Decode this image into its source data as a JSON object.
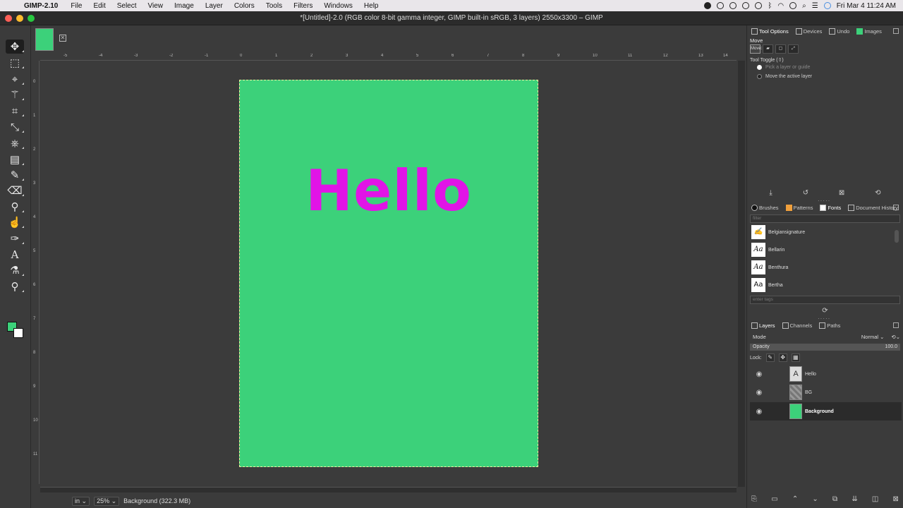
{
  "macos_menubar": {
    "app_name": "GIMP-2.10",
    "menus": [
      "File",
      "Edit",
      "Select",
      "View",
      "Image",
      "Layer",
      "Colors",
      "Tools",
      "Filters",
      "Windows",
      "Help"
    ],
    "clock": "Fri Mar 4  11:24 AM"
  },
  "window": {
    "title": "*[Untitled]-2.0 (RGB color 8-bit gamma integer, GIMP built-in sRGB, 3 layers) 2550x3300 – GIMP"
  },
  "toolbox": {
    "tools": [
      "move-icon",
      "rect-select-icon",
      "free-select-icon",
      "fuzzy-select-icon",
      "crop-icon",
      "unified-transform-icon",
      "warp-icon",
      "gradient-icon",
      "paintbrush-icon",
      "eraser-icon",
      "clone-icon",
      "smudge-icon",
      "paths-icon",
      "text-icon",
      "color-picker-icon",
      "zoom-icon"
    ],
    "foreground_color": "#3cd17a",
    "background_color": "#ffffff"
  },
  "rulers": {
    "horizontal_ticks": [
      "-5",
      "-4",
      "-3",
      "-2",
      "-1",
      "0",
      "1",
      "2",
      "3",
      "4",
      "5",
      "6",
      "7",
      "8",
      "9",
      "10",
      "11",
      "12",
      "13",
      "14"
    ],
    "vertical_ticks": [
      "0",
      "1",
      "2",
      "3",
      "4",
      "5",
      "6",
      "7",
      "8",
      "9",
      "10",
      "11"
    ]
  },
  "canvas": {
    "text": "Hello",
    "background_color": "#3cd17a",
    "text_color": "#e114e6"
  },
  "statusbar": {
    "unit": "in",
    "zoom": "25%",
    "info": "Background (322.3 MB)"
  },
  "tool_options": {
    "tabs": [
      "Tool Options",
      "Devices",
      "Undo",
      "Images"
    ],
    "tool_name": "Move",
    "move_label": "Move:",
    "toggle_label": "Tool Toggle  (⇧)",
    "option_pick": "Pick a layer or guide",
    "option_move": "Move the active layer"
  },
  "resources": {
    "tabs": [
      "Brushes",
      "Patterns",
      "Fonts",
      "Document History"
    ],
    "filter_placeholder": "filter",
    "tags_placeholder": "enter tags",
    "fonts": [
      "Belgiansignature",
      "Bellarin",
      "Benthura",
      "Bertha"
    ]
  },
  "layers_panel": {
    "tabs": [
      "Layers",
      "Channels",
      "Paths"
    ],
    "mode_label": "Mode",
    "mode_value": "Normal",
    "opacity_label": "Opacity",
    "opacity_value": "100.0",
    "lock_label": "Lock:",
    "layers": [
      "Hello",
      "BG",
      "Background"
    ]
  },
  "colors": {
    "accent_green": "#3cd17a",
    "text_magenta": "#e114e6"
  }
}
